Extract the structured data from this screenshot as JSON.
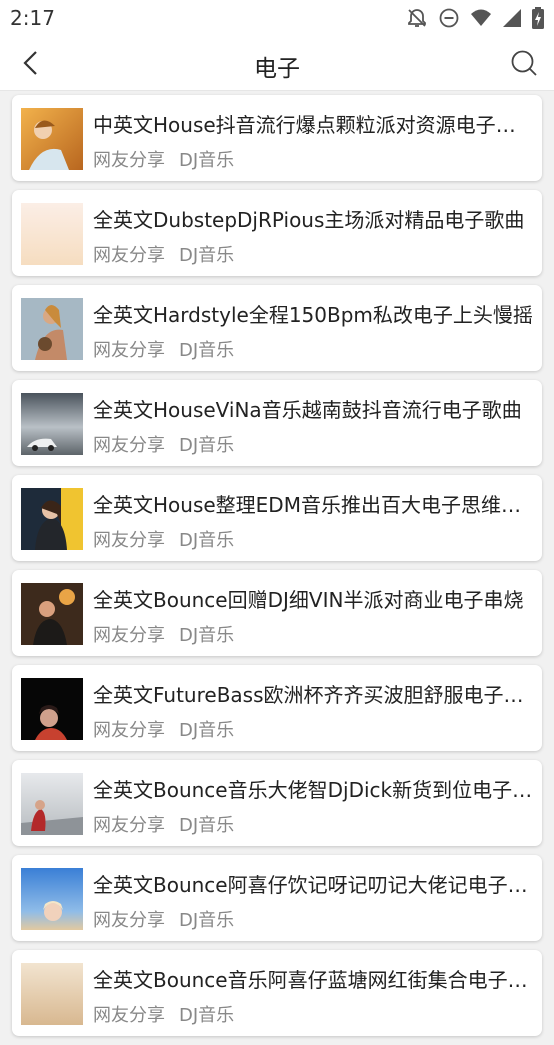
{
  "status_bar": {
    "time": "2:17",
    "icons": [
      "bell-off-icon",
      "do-not-disturb-icon",
      "wifi-icon",
      "signal-icon",
      "battery-charging-icon"
    ]
  },
  "header": {
    "title": "电子",
    "back_icon": "chevron-left-icon",
    "search_icon": "search-icon"
  },
  "songs": [
    {
      "title": "中英文House抖音流行爆点颗粒派对资源电子歌曲",
      "source": "网友分享",
      "category": "DJ音乐"
    },
    {
      "title": "全英文DubstepDjRPious主场派对精品电子歌曲",
      "source": "网友分享",
      "category": "DJ音乐"
    },
    {
      "title": "全英文Hardstyle全程150Bpm私改电子上头慢摇",
      "source": "网友分享",
      "category": "DJ音乐"
    },
    {
      "title": "全英文HouseViNa音乐越南鼓抖音流行电子歌曲",
      "source": "网友分享",
      "category": "DJ音乐"
    },
    {
      "title": "全英文House整理EDM音乐推出百大电子思维串烧",
      "source": "网友分享",
      "category": "DJ音乐"
    },
    {
      "title": "全英文Bounce回赠DJ细VIN半派对商业电子串烧",
      "source": "网友分享",
      "category": "DJ音乐"
    },
    {
      "title": "全英文FutureBass欧洲杯齐齐买波胆舒服电子串烧",
      "source": "网友分享",
      "category": "DJ音乐"
    },
    {
      "title": "全英文Bounce音乐大佬智DjDick新货到位电子串烧",
      "source": "网友分享",
      "category": "DJ音乐"
    },
    {
      "title": "全英文Bounce阿喜仔饮记呀记叨记大佬记电子串烧",
      "source": "网友分享",
      "category": "DJ音乐"
    },
    {
      "title": "全英文Bounce音乐阿喜仔蓝塘网红街集合电子串烧",
      "source": "网友分享",
      "category": "DJ音乐"
    }
  ]
}
